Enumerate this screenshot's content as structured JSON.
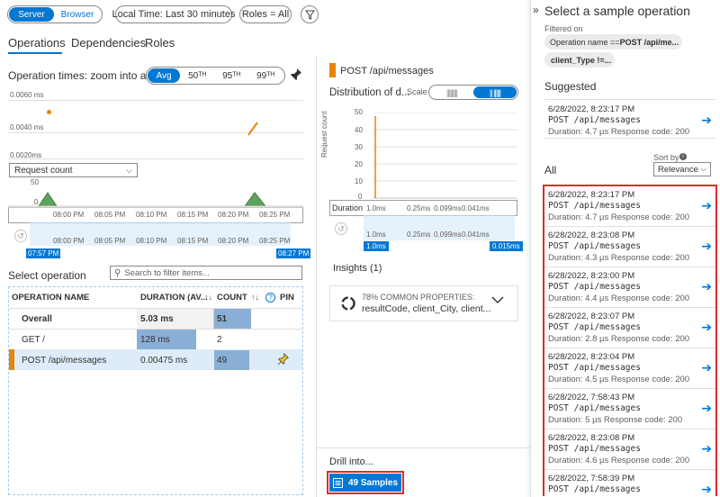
{
  "toolbar": {
    "server": "Server",
    "browser": "Browser",
    "local_time": "Local Time: Last 30 minutes",
    "roles": "Roles = All"
  },
  "tabs": [
    "Operations",
    "Dependencies",
    "Roles"
  ],
  "op_times": {
    "title": "Operation times: zoom into a ra...",
    "avg": "Avg",
    "p50": "50ᵀᴴ",
    "p95": "95ᵀᴴ",
    "p99": "99ᵀᴴ",
    "y_labels": [
      "0.0060 ms",
      "0.0040 ms",
      "0.0020ms"
    ],
    "dropdown": "Request count",
    "count_labels": [
      "50",
      "0"
    ],
    "x_labels": [
      "08:00 PM",
      "08:05 PM",
      "08:10 PM",
      "08:15 PM",
      "08:20 PM",
      "08:25 PM"
    ],
    "range_start": "07:57 PM",
    "range_end": "08:27 PM"
  },
  "select_op": {
    "title": "Select operation",
    "filter_placeholder": "Search to filter items...",
    "headers": [
      "OPERATION NAME",
      "DURATION (AV...",
      "COUNT",
      "PIN"
    ],
    "rows": [
      {
        "name": "Overall",
        "duration": "5.03 ms",
        "count": "51"
      },
      {
        "name": "GET /",
        "duration": "128 ms",
        "count": "2"
      },
      {
        "name": "POST /api/messages",
        "duration": "0.00475 ms",
        "count": "49"
      }
    ]
  },
  "middle": {
    "op_name": "POST /api/messages",
    "dist_title": "Distribution of d...",
    "scale": "Scale",
    "y_label": "Request count",
    "y_ticks": [
      "50",
      "40",
      "30",
      "20",
      "10",
      "0"
    ],
    "duration": "Duration",
    "dur_ticks": [
      "1.0ms",
      "0.25ms",
      "0.099ms",
      "0.041ms"
    ],
    "range_start": "1.0ms",
    "range_end": "0.015ms",
    "insights": "Insights (1)",
    "insight_pct": "78% COMMON PROPERTIES:",
    "insight_props": "resultCode, client_City, client...",
    "drill": "Drill into...",
    "samples_btn": "49 Samples"
  },
  "right": {
    "title": "Select a sample operation",
    "filtered_on": "Filtered on",
    "filter1_prefix": "Operation name == ",
    "filter1_value": "POST /api/me...",
    "filter2": "client_Type !=...",
    "suggested": "Suggested",
    "suggested_item": {
      "time": "6/28/2022, 8:23:17 PM",
      "op": "POST /api/messages",
      "dur": "Duration: 4.7 µs  Response code: 200"
    },
    "sort_by": "Sort by",
    "sort_value": "Relevance",
    "all": "All",
    "items": [
      {
        "time": "6/28/2022, 8:23:17 PM",
        "op": "POST /api/messages",
        "dur": "Duration: 4.7 µs  Response code: 200"
      },
      {
        "time": "6/28/2022, 8:23:08 PM",
        "op": "POST /api/messages",
        "dur": "Duration: 4.3 µs  Response code: 200"
      },
      {
        "time": "6/28/2022, 8:23:00 PM",
        "op": "POST /api/messages",
        "dur": "Duration: 4.4 µs  Response code: 200"
      },
      {
        "time": "6/28/2022, 8:23:07 PM",
        "op": "POST /api/messages",
        "dur": "Duration: 2.8 µs  Response code: 200"
      },
      {
        "time": "6/28/2022, 8:23:04 PM",
        "op": "POST /api/messages",
        "dur": "Duration: 4.5 µs  Response code: 200"
      },
      {
        "time": "6/28/2022, 7:58:43 PM",
        "op": "POST /api/messages",
        "dur": "Duration: 5 µs  Response code: 200"
      },
      {
        "time": "6/28/2022, 8:23:08 PM",
        "op": "POST /api/messages",
        "dur": "Duration: 4.6 µs  Response code: 200"
      },
      {
        "time": "6/28/2022, 7:58:39 PM",
        "op": "POST /api/messages",
        "dur": ""
      }
    ]
  }
}
